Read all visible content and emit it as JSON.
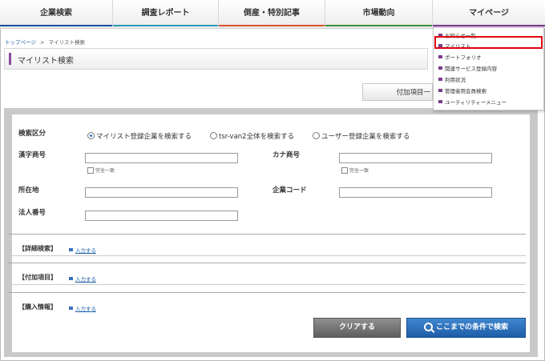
{
  "nav": {
    "items": [
      {
        "label": "企業検索",
        "color": "#1b4f9c"
      },
      {
        "label": "調査レポート",
        "color": "#2a9bb5"
      },
      {
        "label": "倒産・特別記事",
        "color": "#d9532b"
      },
      {
        "label": "市場動向",
        "color": "#3f8f3a"
      },
      {
        "label": "マイページ",
        "color": "#7a3b8a"
      }
    ]
  },
  "breadcrumb": {
    "home": "トップページ",
    "separator": ">",
    "current": "マイリスト検索"
  },
  "page": {
    "title": "マイリスト検索"
  },
  "extra_items_button": "付加項目一",
  "dropdown": {
    "items": [
      "お知らせ一覧",
      "マイリスト",
      "ポートフォリオ",
      "関連サービス登録内容",
      "利用状況",
      "管理者用会員検索",
      "ユーティリティーメニュー"
    ],
    "highlighted_index": 1,
    "highlight_color": "#e00010"
  },
  "form": {
    "search_type": {
      "label": "検索区分",
      "options": [
        "マイリスト登録企業を検索する",
        "tsr-van2全体を検索する",
        "ユーザー登録企業を検索する"
      ],
      "selected_index": 0
    },
    "kanji_name": {
      "label": "漢字商号",
      "value": "",
      "exact_match_label": "完全一致"
    },
    "kana_name": {
      "label": "カナ商号",
      "value": "",
      "exact_match_label": "完全一致"
    },
    "address": {
      "label": "所在地",
      "value": ""
    },
    "company_code": {
      "label": "企業コード",
      "value": ""
    },
    "corporate_number": {
      "label": "法人番号",
      "value": ""
    }
  },
  "sections": [
    {
      "label": "【詳細検索】",
      "link": "入力する"
    },
    {
      "label": "【付加項目】",
      "link": "入力する"
    },
    {
      "label": "【購入情報】",
      "link": "入力する"
    }
  ],
  "buttons": {
    "clear": "クリアする",
    "search": "ここまでの条件で検索"
  }
}
